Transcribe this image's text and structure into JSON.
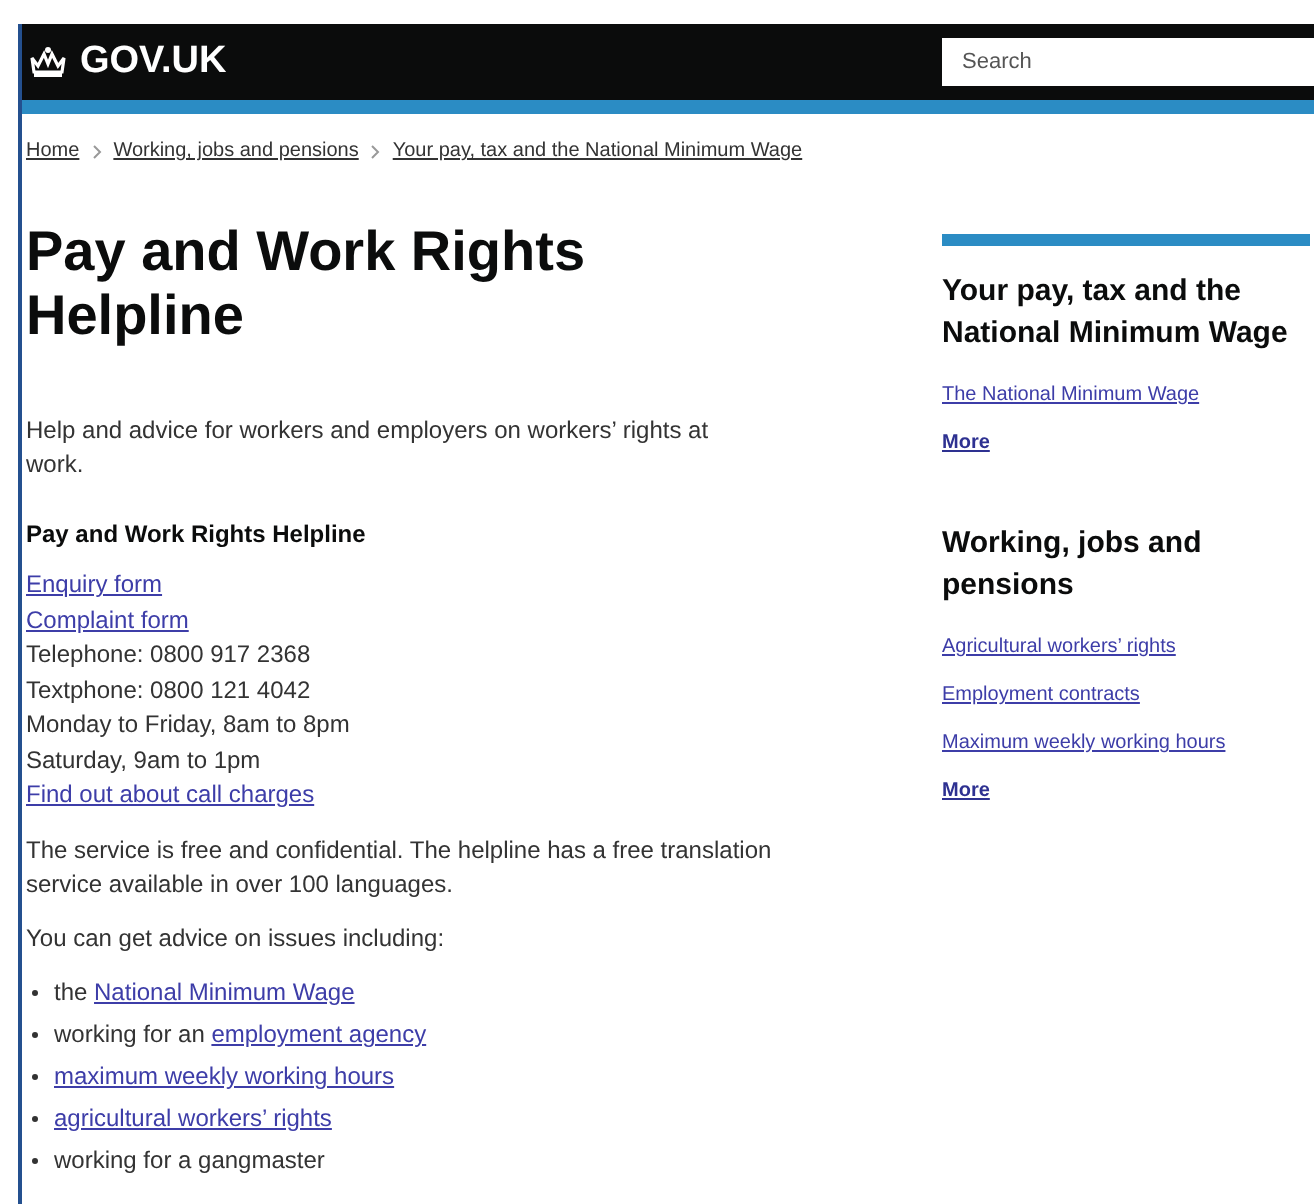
{
  "header": {
    "logo": "GOV.UK",
    "search": {
      "placeholder": "Search"
    }
  },
  "breadcrumbs": [
    "Home",
    "Working, jobs and pensions",
    "Your pay, tax and the National Minimum Wage"
  ],
  "title": "Pay and Work Rights Helpline",
  "summary": "Help and advice for workers and employers on workers’ rights at work.",
  "section_heading": "Pay and Work Rights Helpline",
  "contact_lines": [
    {
      "text": "Enquiry form",
      "link": true
    },
    {
      "text": "Complaint form",
      "link": true
    },
    {
      "text": "Telephone: 0800 917 2368",
      "link": false
    },
    {
      "text": "Textphone: 0800 121 4042",
      "link": false
    },
    {
      "text": "Monday to Friday, 8am to 8pm",
      "link": false
    },
    {
      "text": "Saturday, 9am to 1pm",
      "link": false
    },
    {
      "text": "Find out about call charges",
      "link": true
    }
  ],
  "paragraphs": [
    "The service is free and confidential. The helpline has a free translation service available in over 100 languages.",
    "You can get advice on issues including:"
  ],
  "issues": [
    [
      {
        "text": "the ",
        "link": false
      },
      {
        "text": "National Minimum Wage",
        "link": true
      }
    ],
    [
      {
        "text": "working for an ",
        "link": false
      },
      {
        "text": "employment agency",
        "link": true
      }
    ],
    [
      {
        "text": "maximum weekly working hours",
        "link": true
      }
    ],
    [
      {
        "text": "agricultural workers’ rights",
        "link": true
      }
    ],
    [
      {
        "text": "working for a gangmaster",
        "link": false
      }
    ]
  ],
  "sidebar": [
    {
      "heading": "Your pay, tax and the National Minimum Wage",
      "links": [
        "The National Minimum Wage"
      ],
      "more": "More"
    },
    {
      "heading": "Working, jobs and pensions",
      "links": [
        "Agricultural workers’ rights",
        "Employment contracts",
        "Maximum weekly working hours"
      ],
      "more": "More"
    }
  ]
}
